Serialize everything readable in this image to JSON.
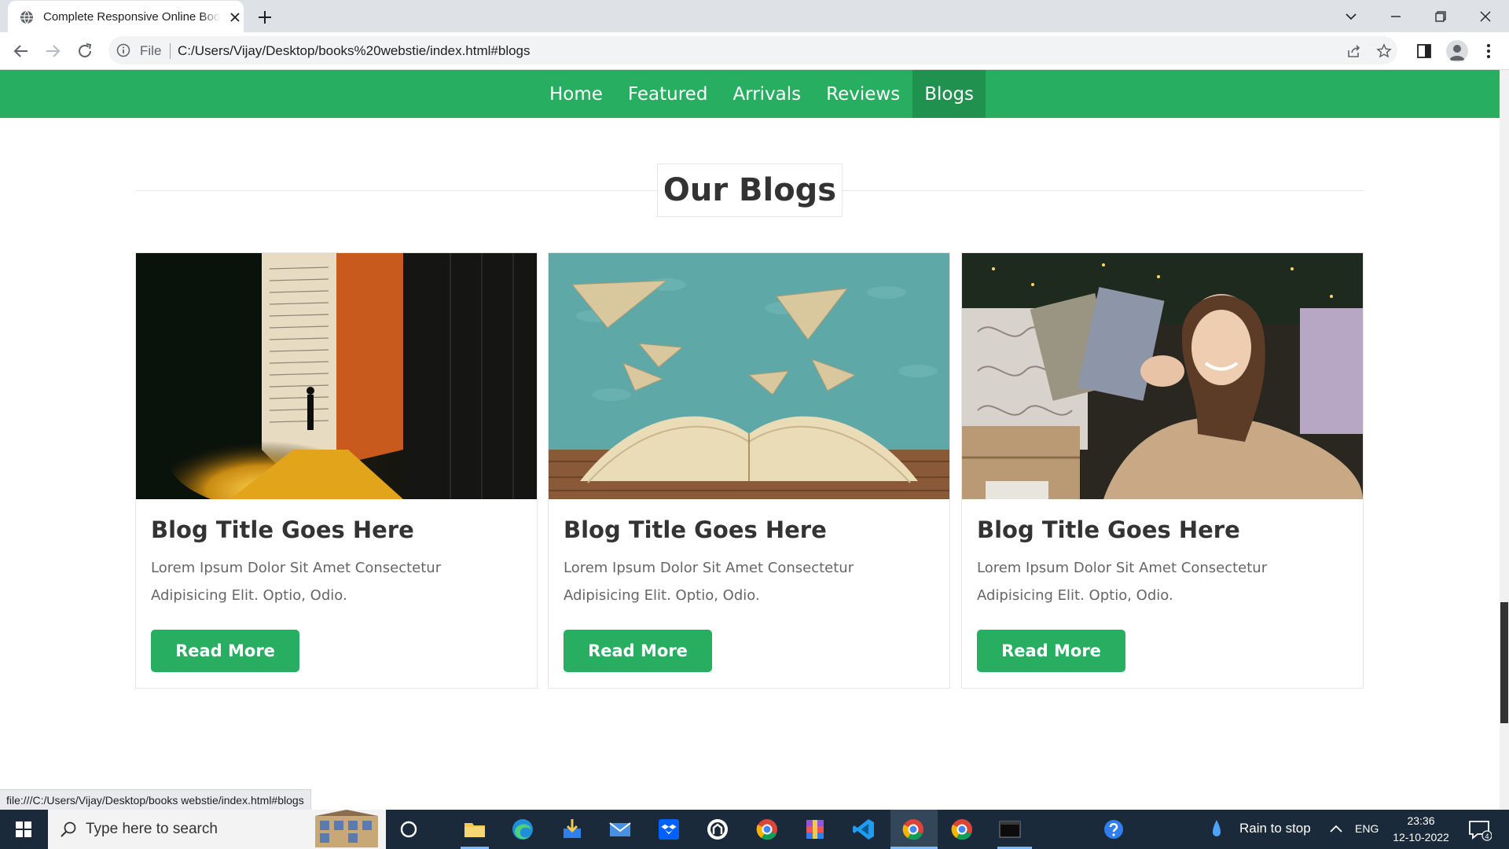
{
  "browser": {
    "tab_title": "Complete Responsive Online Book Store",
    "file_label": "File",
    "url": "C:/Users/Vijay/Desktop/books%20webstie/index.html#blogs",
    "status_url": "file:///C:/Users/Vijay/Desktop/books webstie/index.html#blogs"
  },
  "site": {
    "nav": [
      {
        "label": "Home"
      },
      {
        "label": "Featured"
      },
      {
        "label": "Arrivals"
      },
      {
        "label": "Reviews"
      },
      {
        "label": "Blogs"
      }
    ],
    "active_nav": "Blogs",
    "accent_color": "#27ae60",
    "section_heading": "Our Blogs",
    "blogs": [
      {
        "image": "book-with-tiny-figure-image",
        "title": "Blog Title Goes Here",
        "description": "Lorem Ipsum Dolor Sit Amet Consectetur Adipisicing Elit. Optio, Odio.",
        "button": "Read More"
      },
      {
        "image": "open-book-paper-planes-image",
        "title": "Blog Title Goes Here",
        "description": "Lorem Ipsum Dolor Sit Amet Consectetur Adipisicing Elit. Optio, Odio.",
        "button": "Read More"
      },
      {
        "image": "woman-holding-books-image",
        "title": "Blog Title Goes Here",
        "description": "Lorem Ipsum Dolor Sit Amet Consectetur Adipisicing Elit. Optio, Odio.",
        "button": "Read More"
      }
    ]
  },
  "taskbar": {
    "search_placeholder": "Type here to search",
    "weather": "Rain to stop",
    "language": "ENG",
    "time": "23:36",
    "date": "12-10-2022",
    "notification_count": "4"
  }
}
